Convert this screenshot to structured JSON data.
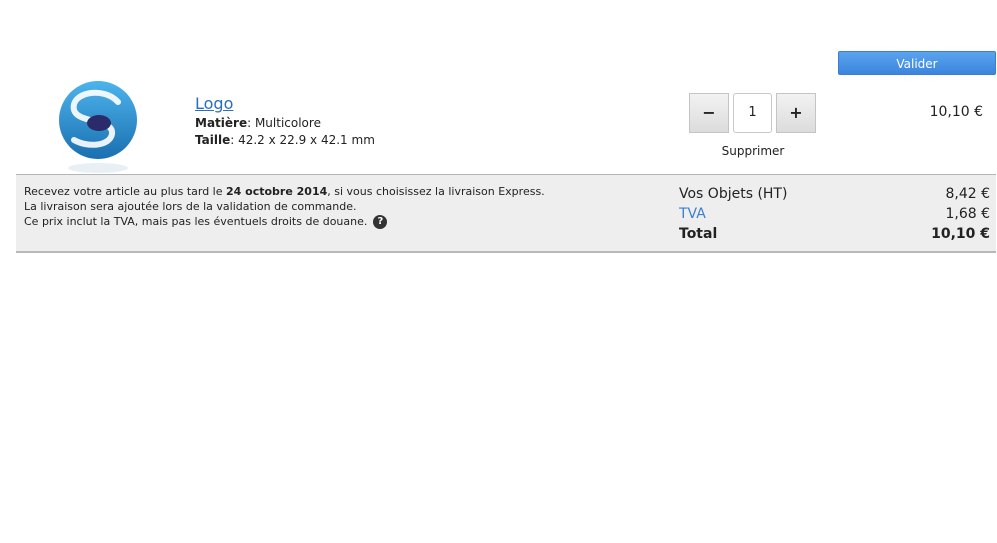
{
  "actions": {
    "validate_label": "Valider"
  },
  "product": {
    "name": "Logo",
    "material_label": "Matière",
    "material_value": ": Multicolore",
    "size_label": "Taille",
    "size_value": ": 42.2 x 22.9 x 42.1 mm",
    "quantity": "1",
    "minus_label": "−",
    "plus_label": "+",
    "remove_label": "Supprimer",
    "price": "10,10 €"
  },
  "delivery": {
    "line1_pre": "Recevez votre article au plus tard le ",
    "line1_date": "24 octobre 2014",
    "line1_post": ", si vous choisissez la livraison Express.",
    "line2": "La livraison sera ajoutée lors de la validation de commande.",
    "line3": "Ce prix inclut la TVA, mais pas les éventuels droits de douane.",
    "help_icon": "?"
  },
  "totals": {
    "objects_label": "Vos Objets (HT)",
    "objects_value": "8,42 €",
    "tva_label": "TVA",
    "tva_value": "1,68 €",
    "total_label": "Total",
    "total_value": "10,10 €"
  },
  "colors": {
    "accent": "#3b86dd",
    "link": "#2a6ebd",
    "summary_bg": "#eeeeee"
  }
}
